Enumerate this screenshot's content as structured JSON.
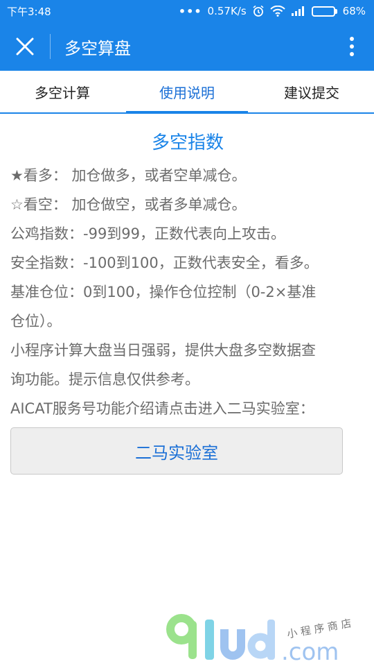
{
  "status_bar": {
    "time": "下午3:48",
    "network_speed": "0.57K/s",
    "battery_percent": "68%",
    "battery_level": 0.68
  },
  "navbar": {
    "title": "多空算盘",
    "close_icon": "close-icon",
    "more_icon": "more-vertical-icon"
  },
  "tabs": [
    {
      "label": "多空计算",
      "active": false
    },
    {
      "label": "使用说明",
      "active": true
    },
    {
      "label": "建议提交",
      "active": false
    }
  ],
  "content": {
    "title": "多空指数",
    "lines": [
      "★看多： 加仓做多，或者空单减仓。",
      "☆看空： 加仓做空，或者多单减仓。",
      "公鸡指数：-99到99，正数代表向上攻击。",
      "安全指数：-100到100，正数代表安全，看多。",
      "基准仓位：0到100，操作仓位控制（0-2×基准",
      "仓位）。",
      "小程序计算大盘当日强弱，提供大盘多空数据查",
      "询功能。提示信息仅供参考。",
      "AICAT服务号功能介绍请点击进入二马实验室："
    ],
    "button_label": "二马实验室"
  },
  "watermark": {
    "brand": "91ud.com",
    "tagline": "小程序商店"
  },
  "colors": {
    "primary": "#1a84e8",
    "link_text": "#1a6fd6",
    "body_text": "#6b6b6b"
  }
}
